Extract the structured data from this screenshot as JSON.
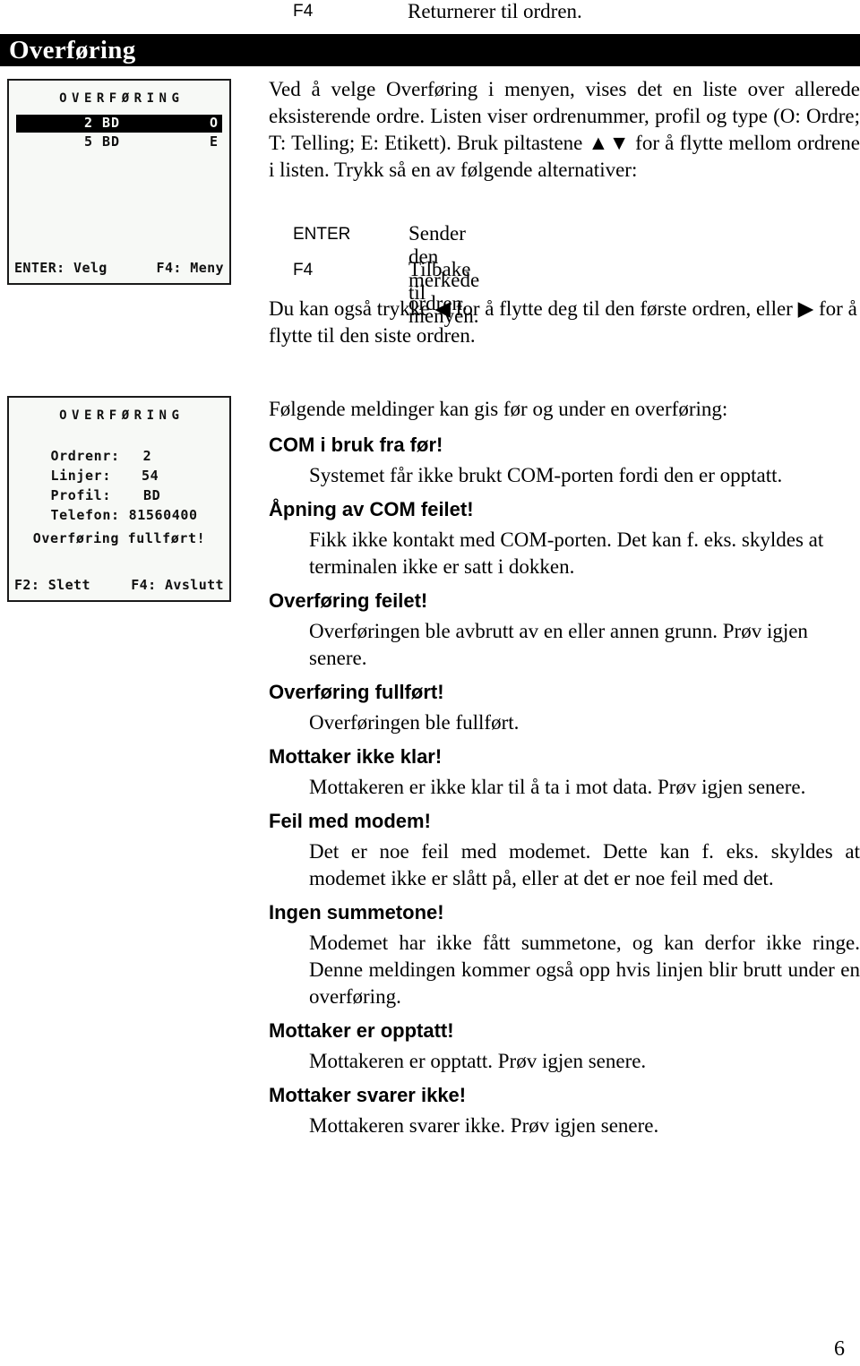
{
  "carryover": {
    "key": "F4",
    "description": "Returnerer til ordren."
  },
  "chapter": {
    "title": "Overføring"
  },
  "lcd_screens": [
    {
      "name": "order-list-screen",
      "header": "OVERFØRING",
      "rows": [
        {
          "order": "2",
          "profile": "BD",
          "type": "O",
          "selected": true
        },
        {
          "order": "5",
          "profile": "BD",
          "type": "E",
          "selected": false
        }
      ],
      "footer_left": "ENTER: Velg",
      "footer_right": "F4: Meny"
    },
    {
      "name": "transfer-detail-screen",
      "header": "OVERFØRING",
      "fields": [
        {
          "label": "Ordrenr:",
          "value": "2"
        },
        {
          "label": "Linjer:",
          "value": "54"
        },
        {
          "label": "Profil:",
          "value": "BD"
        },
        {
          "label": "Telefon:",
          "value": "81560400"
        }
      ],
      "status": "Overføring fullført!",
      "footer_left": "F2: Slett",
      "footer_right": "F4: Avslutt"
    }
  ],
  "intro": {
    "paragraph": "Ved å velge Overføring i menyen, vises det en liste over allerede eksisterende ordre. Listen viser ordrenummer, profil og type (O: Ordre; T: Telling; E: Etikett). Bruk piltastene ▲▼ for å flytte mellom ordrene i listen. Trykk så en av følgende alternativer:",
    "key_options": [
      {
        "key": "ENTER",
        "description": "Sender den merkede ordren."
      },
      {
        "key": "F4",
        "description": "Tilbake til menyen."
      }
    ],
    "extra_paragraph": "Du kan også trykke ◀ for å flytte deg til den første ordren, eller ▶ for å flytte til den siste ordren."
  },
  "messages": {
    "lead": "Følgende meldinger kan gis før og under en overføring:",
    "items": [
      {
        "heading": "COM i bruk fra før!",
        "body": "Systemet får ikke brukt COM-porten fordi den er opptatt."
      },
      {
        "heading": "Åpning av COM feilet!",
        "body": "Fikk ikke kontakt med COM-porten. Det kan f. eks. skyldes at terminalen ikke er satt i dokken."
      },
      {
        "heading": "Overføring feilet!",
        "body": "Overføringen ble avbrutt av en eller annen grunn. Prøv igjen senere."
      },
      {
        "heading": "Overføring fullført!",
        "body": "Overføringen ble fullført."
      },
      {
        "heading": "Mottaker ikke klar!",
        "body": "Mottakeren er ikke klar til å ta i mot data. Prøv igjen senere."
      },
      {
        "heading": "Feil med modem!",
        "body": "Det er noe feil med modemet. Dette kan f. eks. skyldes at modemet ikke er slått på, eller at det er noe feil med det."
      },
      {
        "heading": "Ingen summetone!",
        "body": "Modemet har ikke fått summetone, og kan derfor ikke ringe. Denne meldingen kommer også opp hvis linjen blir brutt under en overføring."
      },
      {
        "heading": "Mottaker er opptatt!",
        "body": "Mottakeren er opptatt. Prøv igjen senere."
      },
      {
        "heading": "Mottaker svarer ikke!",
        "body": "Mottakeren svarer ikke. Prøv igjen senere."
      }
    ]
  },
  "footer": {
    "page_number": "6"
  }
}
